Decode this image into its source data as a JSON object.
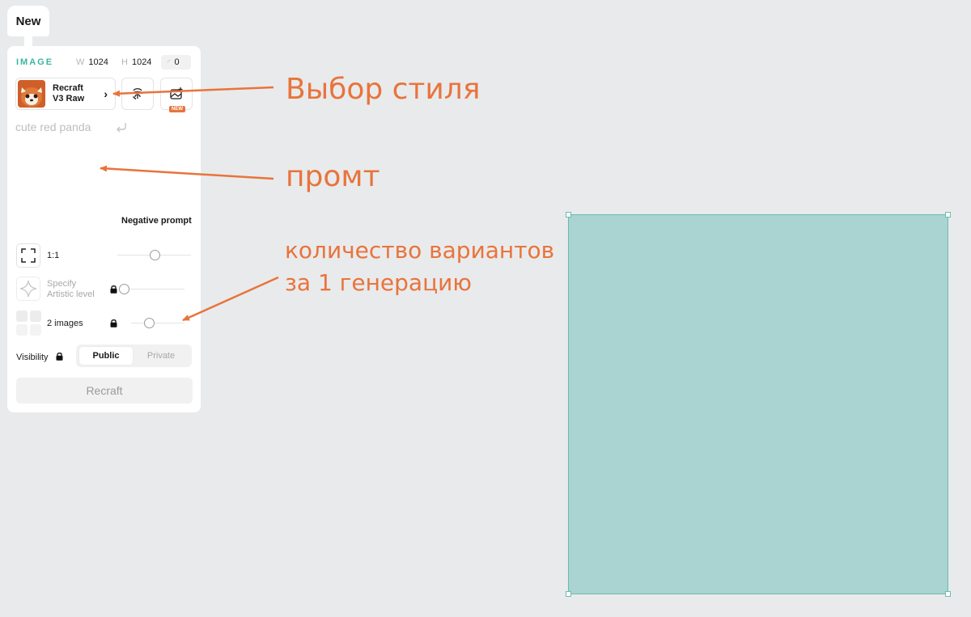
{
  "tab": {
    "label": "New"
  },
  "panel": {
    "section_label": "IMAGE",
    "width": {
      "key": "W",
      "value": "1024"
    },
    "height": {
      "key": "H",
      "value": "1024"
    },
    "seed": {
      "value": "0"
    },
    "style": {
      "line1": "Recraft",
      "line2": "V3 Raw"
    },
    "image_button": {
      "badge": "NEW"
    },
    "prompt": {
      "placeholder": "cute red panda"
    },
    "negative_prompt_label": "Negative prompt",
    "aspect": {
      "label": "1:1",
      "level": 0.5
    },
    "artistic": {
      "line1": "Specify",
      "line2": "Artistic level",
      "level": 0.0
    },
    "images": {
      "label": "2 images",
      "level": 0.33
    },
    "visibility": {
      "label": "Visibility",
      "options": [
        "Public",
        "Private"
      ],
      "selected": "Public"
    },
    "submit_label": "Recraft"
  },
  "annotations": {
    "style_choice": "Выбор стиля",
    "prompt": "промт",
    "variants_line1": "количество вариантов",
    "variants_line2": "за 1 генерацию"
  },
  "colors": {
    "accent": "#3bb5a2",
    "annotation": "#e8743b",
    "canvas_fill": "#a9d4d2",
    "canvas_border": "#6cbcae",
    "background": "#e9eaec"
  }
}
